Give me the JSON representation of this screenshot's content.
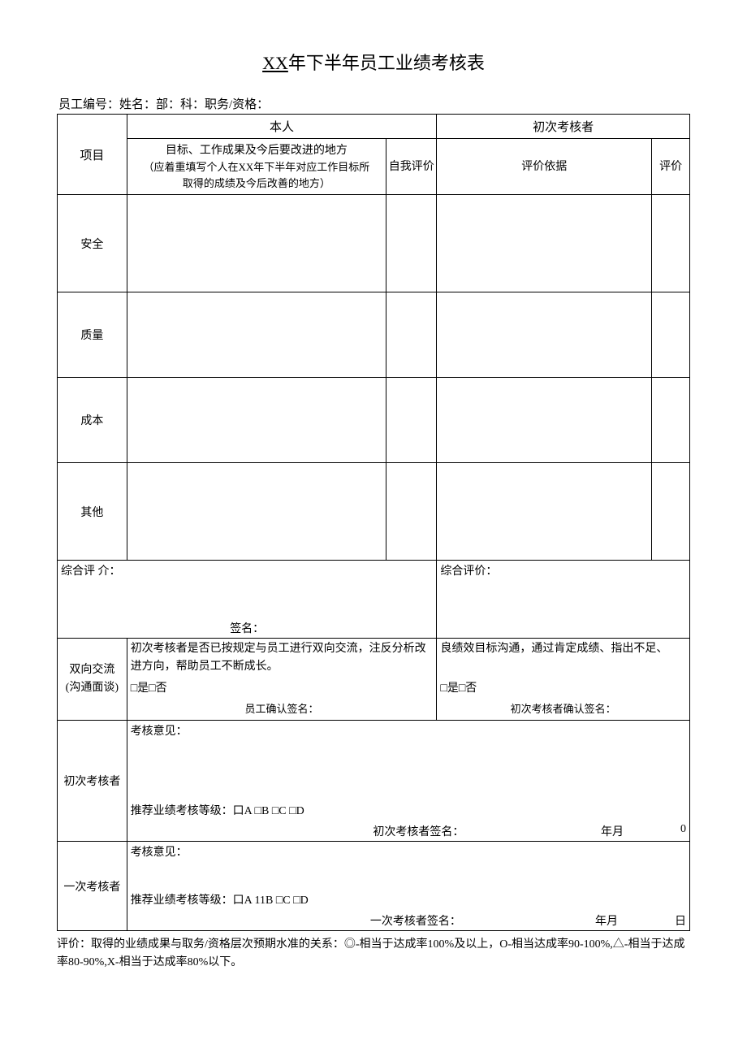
{
  "title_prefix": "XX",
  "title_rest": "年下半年员工业绩考核表",
  "meta_line": "员工编号：姓名：部：科：职务/资格：",
  "headers": {
    "self": "本人",
    "first_eval": "初次考核者",
    "item": "项目",
    "goal_line1": "目标、工作成果及今后要改进的地方",
    "goal_line2": "（应着重填写个人在XX年下半年对应工作目标所",
    "goal_line3": "取得的成绩及今后改善的地方）",
    "self_eval": "自我评价",
    "eval_basis": "评价依据",
    "eval": "评价"
  },
  "items": [
    "安全",
    "质量",
    "成本",
    "其他"
  ],
  "summary": {
    "left_label": "综合评 介：",
    "left_sign": "签名：",
    "right_label": "综合评价："
  },
  "dialogue": {
    "row_label_1": "双向交流",
    "row_label_2": "(沟通面谈)",
    "left_text": "初次考核者是否已按规定与员工进行双向交流，注反分析改进方向，帮助员工不断成长。",
    "right_text": "良绩效目标沟通，通过肯定成绩、指出不足、",
    "yes_no": "□是□否",
    "left_sign": "员工确认签名：",
    "right_sign": "初次考核者确认签名："
  },
  "evaluator1": {
    "label": "初次考核者",
    "opinion": "考核意见：",
    "levels": "推荐业绩考核等级：口A             □B             □C           □D",
    "sign": "初次考核者签名：",
    "date": "年月",
    "tail": "0"
  },
  "evaluator2": {
    "label": "一次考核者",
    "opinion": "考核意见：",
    "levels": "推荐业绩考核等级：口A            11B             □C           □D",
    "sign": "一次考核者签名：",
    "date": "年月",
    "tail": "日"
  },
  "footnote": "评价：取得的业绩成果与取务/资格层次预期水准的关系：◎-相当于达成率100%及以上，O-相当达成率90-100%,△-相当于达成率80-90%,X-相当于达成率80%以下。"
}
